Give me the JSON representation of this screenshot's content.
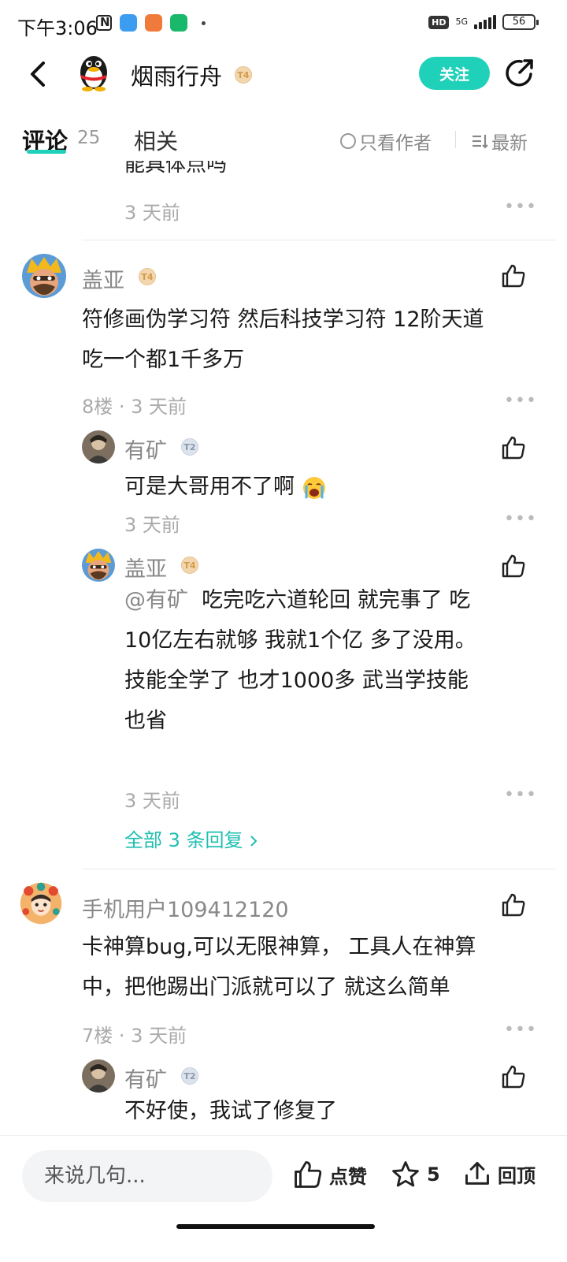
{
  "status_bar": {
    "time": "下午3:06",
    "hd": "HD",
    "network": "5G",
    "battery": "56"
  },
  "header": {
    "title": "烟雨行舟",
    "title_level": "T4",
    "follow_label": "关注"
  },
  "tabs": {
    "comments_label": "评论",
    "comments_count": "25",
    "related_label": "相关",
    "author_only_label": "只看作者",
    "sort_label": "最新"
  },
  "feed": {
    "partial_text": "能具体点吗",
    "partial_time": "3 天前",
    "threads": [
      {
        "user": "盖亚",
        "level": "T4",
        "text_line1": "符修画伪学习符 然后科技学习符 12阶天道",
        "text_line2": "吃一个都1千多万",
        "meta": "8楼 · 3 天前",
        "replies": [
          {
            "user": "有矿",
            "level": "T2",
            "text": "可是大哥用不了啊",
            "time": "3 天前"
          },
          {
            "user": "盖亚",
            "level": "T4",
            "mention": "@有矿",
            "text_line1": "吃完吃六道轮回 就完事了 吃",
            "text_line2": "10亿左右就够 我就1个亿 多了没用。",
            "text_line3": "技能全学了 也才1000多 武当学技能",
            "text_line4": "也省",
            "time": "3 天前"
          }
        ],
        "all_replies_label": "全部 3 条回复"
      },
      {
        "user": "手机用户109412120",
        "text_line1": "卡神算bug,可以无限神算， 工具人在神算",
        "text_line2": "中，把他踢出门派就可以了  就这么简单",
        "meta": "7楼 · 3 天前",
        "replies": [
          {
            "user": "有矿",
            "level": "T2",
            "text": "不好使，我试了修复了"
          }
        ]
      }
    ]
  },
  "bottom_bar": {
    "input_placeholder": "来说几句...",
    "like_label": "点赞",
    "favorite_count": "5",
    "top_label": "回顶"
  },
  "colors": {
    "accent": "#1fd1b9",
    "link": "#1fbfb0",
    "username": "#888888"
  }
}
